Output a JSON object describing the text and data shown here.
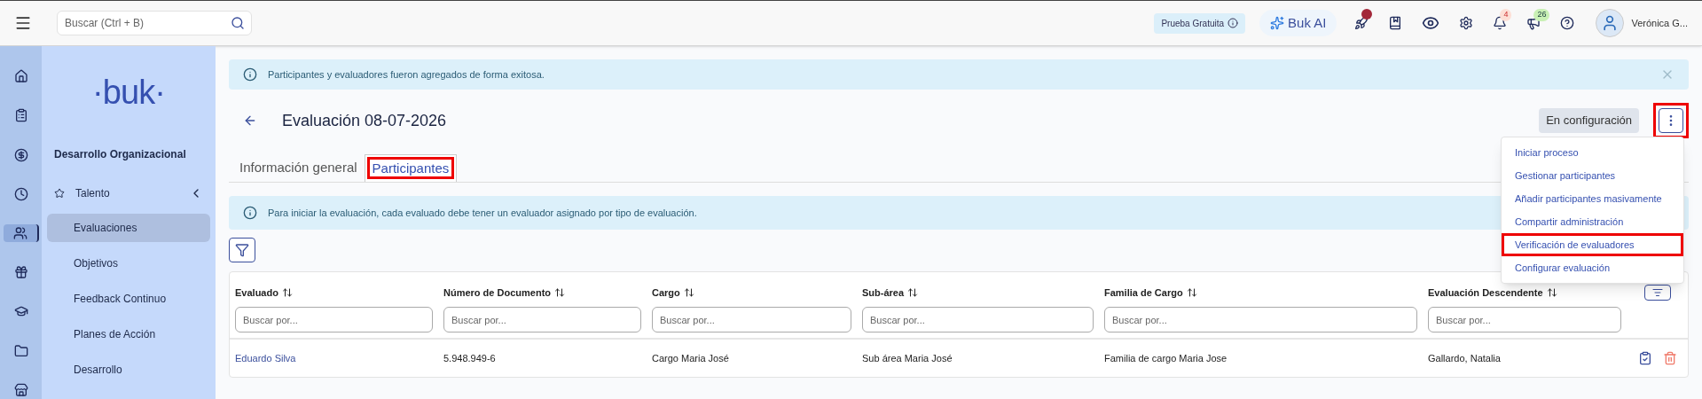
{
  "topbar": {
    "search": {
      "placeholder": "Buscar (Ctrl + B)"
    },
    "trial_badge": "Prueba Gratuita",
    "ai_button": "Buk AI",
    "notifications_count": "4",
    "announcements_count": "26",
    "user_name": "Verónica G..."
  },
  "rail": [
    {
      "selected": false
    },
    {
      "selected": false
    },
    {
      "selected": false
    },
    {
      "selected": false
    },
    {
      "selected": true
    },
    {
      "selected": false
    },
    {
      "selected": false
    },
    {
      "selected": false
    },
    {
      "selected": false
    }
  ],
  "sidebar": {
    "logo": "·buk·",
    "section": "Desarrollo Organizacional",
    "group": {
      "label": "Talento",
      "expanded": true,
      "children": [
        {
          "label": "Evaluaciones",
          "selected": true
        },
        {
          "label": "Objetivos",
          "selected": false
        },
        {
          "label": "Feedback Continuo",
          "selected": false
        },
        {
          "label": "Planes de Acción",
          "selected": false
        },
        {
          "label": "Desarrollo",
          "selected": false
        }
      ]
    }
  },
  "success_alert": "Participantes y evaluadores fueron agregados de forma exitosa.",
  "page": {
    "title": "Evaluación 08-07-2026",
    "status": "En configuración",
    "menu_button_highlighted": true
  },
  "tabs": [
    {
      "label": "Información general",
      "selected": false,
      "highlighted": false
    },
    {
      "label": "Participantes",
      "selected": true,
      "highlighted": true
    }
  ],
  "info_alert": "Para iniciar la evaluación, cada evaluado debe tener un evaluador asignado por tipo de evaluación.",
  "menu": [
    {
      "label": "Iniciar proceso",
      "highlighted": false
    },
    {
      "label": "Gestionar participantes",
      "highlighted": false
    },
    {
      "label": "Añadir participantes masivamente",
      "highlighted": false
    },
    {
      "label": "Compartir administración",
      "highlighted": false
    },
    {
      "label": "Verificación de evaluadores",
      "highlighted": true
    },
    {
      "label": "Configurar evaluación",
      "highlighted": false
    }
  ],
  "table": {
    "columns": [
      {
        "label": "Evaluado",
        "placeholder": "Buscar por..."
      },
      {
        "label": "Número de Documento",
        "placeholder": "Buscar por..."
      },
      {
        "label": "Cargo",
        "placeholder": "Buscar por..."
      },
      {
        "label": "Sub-área",
        "placeholder": "Buscar por..."
      },
      {
        "label": "Familia de Cargo",
        "placeholder": "Buscar por..."
      },
      {
        "label": "Evaluación Descendente",
        "placeholder": "Buscar por..."
      }
    ],
    "rows": [
      {
        "cells": [
          "Eduardo Silva",
          "5.948.949-6",
          "Cargo Maria José",
          "Sub área Maria José",
          "Familia de cargo Maria Jose",
          "Gallardo, Natalia"
        ]
      }
    ]
  }
}
